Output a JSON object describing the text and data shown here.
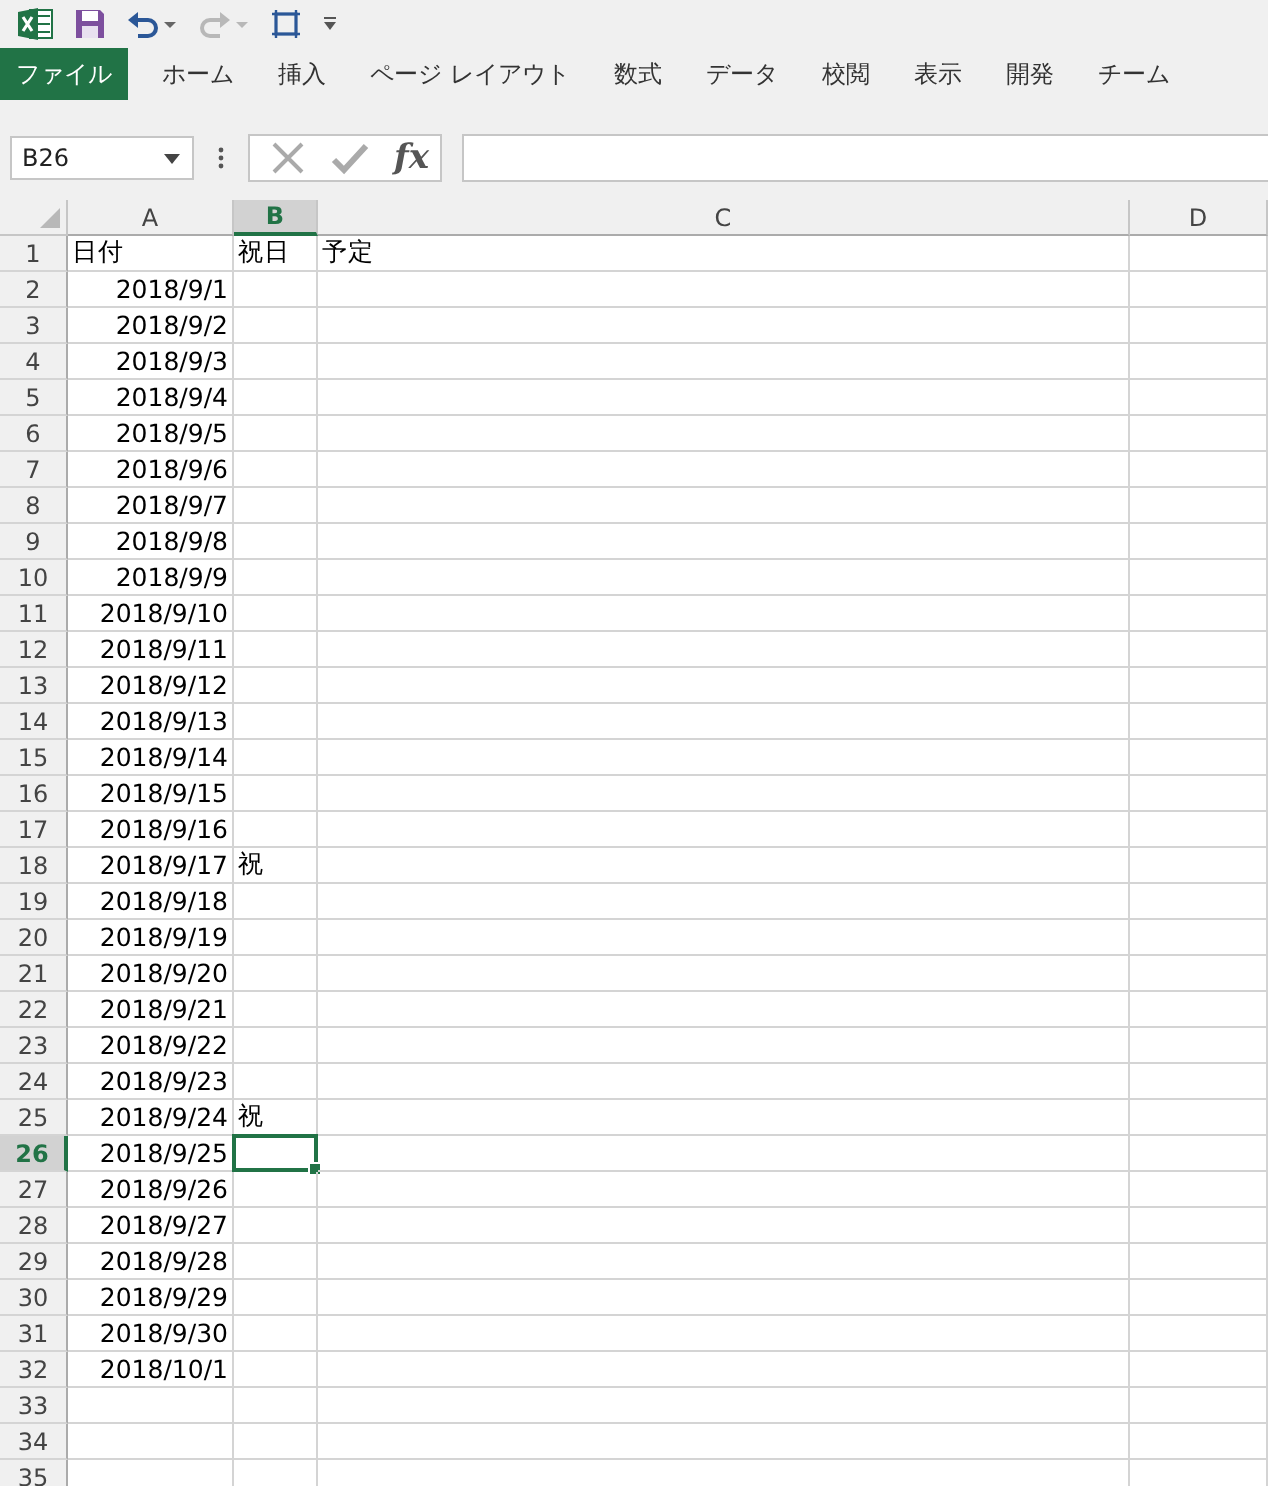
{
  "ribbon_tabs": [
    {
      "label": "ファイル",
      "kind": "file"
    },
    {
      "label": "ホーム",
      "kind": "tab"
    },
    {
      "label": "挿入",
      "kind": "tab"
    },
    {
      "label": "ページ レイアウト",
      "kind": "tab"
    },
    {
      "label": "数式",
      "kind": "tab"
    },
    {
      "label": "データ",
      "kind": "tab"
    },
    {
      "label": "校閲",
      "kind": "tab"
    },
    {
      "label": "表示",
      "kind": "tab"
    },
    {
      "label": "開発",
      "kind": "tab"
    },
    {
      "label": "チーム",
      "kind": "tab"
    }
  ],
  "formula_bar": {
    "name_box": "B26",
    "function_label": "fx"
  },
  "columns": [
    {
      "label": "A",
      "selected": false
    },
    {
      "label": "B",
      "selected": true
    },
    {
      "label": "C",
      "selected": false
    },
    {
      "label": "D",
      "selected": false
    }
  ],
  "rows": [
    {
      "number": "1",
      "selected": false,
      "kind": "text",
      "date": "日付",
      "holiday": "祝日",
      "plan": "予定"
    },
    {
      "number": "2",
      "selected": false,
      "kind": "date",
      "date": "2018/9/1"
    },
    {
      "number": "3",
      "selected": false,
      "kind": "date",
      "date": "2018/9/2"
    },
    {
      "number": "4",
      "selected": false,
      "kind": "date",
      "date": "2018/9/3"
    },
    {
      "number": "5",
      "selected": false,
      "kind": "date",
      "date": "2018/9/4"
    },
    {
      "number": "6",
      "selected": false,
      "kind": "date",
      "date": "2018/9/5"
    },
    {
      "number": "7",
      "selected": false,
      "kind": "date",
      "date": "2018/9/6"
    },
    {
      "number": "8",
      "selected": false,
      "kind": "date",
      "date": "2018/9/7"
    },
    {
      "number": "9",
      "selected": false,
      "kind": "date",
      "date": "2018/9/8"
    },
    {
      "number": "10",
      "selected": false,
      "kind": "date",
      "date": "2018/9/9"
    },
    {
      "number": "11",
      "selected": false,
      "kind": "date",
      "date": "2018/9/10"
    },
    {
      "number": "12",
      "selected": false,
      "kind": "date",
      "date": "2018/9/11"
    },
    {
      "number": "13",
      "selected": false,
      "kind": "date",
      "date": "2018/9/12"
    },
    {
      "number": "14",
      "selected": false,
      "kind": "date",
      "date": "2018/9/13"
    },
    {
      "number": "15",
      "selected": false,
      "kind": "date",
      "date": "2018/9/14"
    },
    {
      "number": "16",
      "selected": false,
      "kind": "date",
      "date": "2018/9/15"
    },
    {
      "number": "17",
      "selected": false,
      "kind": "date",
      "date": "2018/9/16"
    },
    {
      "number": "18",
      "selected": false,
      "kind": "date",
      "date": "2018/9/17",
      "holiday": "祝"
    },
    {
      "number": "19",
      "selected": false,
      "kind": "date",
      "date": "2018/9/18"
    },
    {
      "number": "20",
      "selected": false,
      "kind": "date",
      "date": "2018/9/19"
    },
    {
      "number": "21",
      "selected": false,
      "kind": "date",
      "date": "2018/9/20"
    },
    {
      "number": "22",
      "selected": false,
      "kind": "date",
      "date": "2018/9/21"
    },
    {
      "number": "23",
      "selected": false,
      "kind": "date",
      "date": "2018/9/22"
    },
    {
      "number": "24",
      "selected": false,
      "kind": "date",
      "date": "2018/9/23"
    },
    {
      "number": "25",
      "selected": false,
      "kind": "date",
      "date": "2018/9/24",
      "holiday": "祝"
    },
    {
      "number": "26",
      "selected": true,
      "kind": "date",
      "date": "2018/9/25"
    },
    {
      "number": "27",
      "selected": false,
      "kind": "date",
      "date": "2018/9/26"
    },
    {
      "number": "28",
      "selected": false,
      "kind": "date",
      "date": "2018/9/27"
    },
    {
      "number": "29",
      "selected": false,
      "kind": "date",
      "date": "2018/9/28"
    },
    {
      "number": "30",
      "selected": false,
      "kind": "date",
      "date": "2018/9/29"
    },
    {
      "number": "31",
      "selected": false,
      "kind": "date",
      "date": "2018/9/30"
    },
    {
      "number": "32",
      "selected": false,
      "kind": "date",
      "date": "2018/10/1"
    },
    {
      "number": "33",
      "selected": false
    },
    {
      "number": "34",
      "selected": false
    },
    {
      "number": "35",
      "selected": false
    }
  ]
}
